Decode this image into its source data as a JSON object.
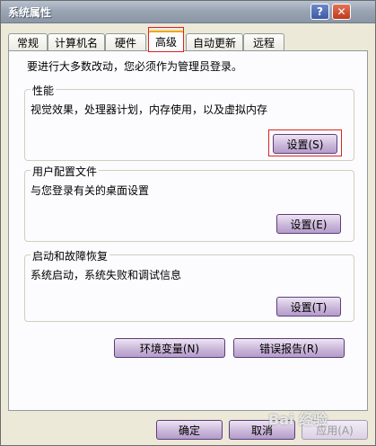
{
  "window": {
    "title": "系统属性",
    "help_glyph": "?",
    "close_glyph": "✕"
  },
  "tabs": [
    {
      "label": "常规"
    },
    {
      "label": "计算机名"
    },
    {
      "label": "硬件"
    },
    {
      "label": "高级"
    },
    {
      "label": "自动更新"
    },
    {
      "label": "远程"
    }
  ],
  "active_tab": "高级",
  "intro": "要进行大多数改动，您必须作为管理员登录。",
  "performance": {
    "title": "性能",
    "desc": "视觉效果，处理器计划，内存使用，以及虚拟内存",
    "button": "设置(S)"
  },
  "user_profiles": {
    "title": "用户配置文件",
    "desc": "与您登录有关的桌面设置",
    "button": "设置(E)"
  },
  "startup_recovery": {
    "title": "启动和故障恢复",
    "desc": "系统启动，系统失败和调试信息",
    "button": "设置(T)"
  },
  "env_button": "环境变量(N)",
  "error_button": "错误报告(R)",
  "footer": {
    "ok": "确定",
    "cancel": "取消",
    "apply": "应用(A)"
  },
  "watermark": "Bai 经验",
  "colors": {
    "highlight_outline": "#e02020",
    "button_border": "#5e3d7a"
  }
}
